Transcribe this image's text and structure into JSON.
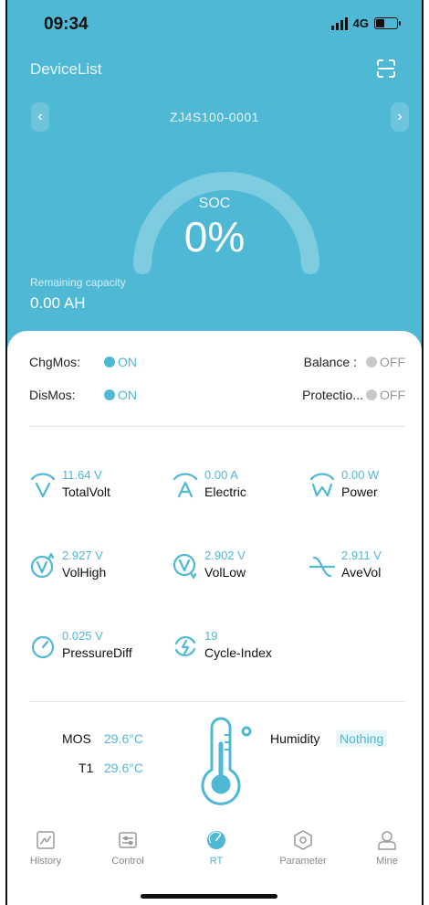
{
  "status": {
    "time": "09:34",
    "network": "4G"
  },
  "header": {
    "title": "DeviceList",
    "device": "ZJ4S100-0001",
    "prev": "‹",
    "next": "›"
  },
  "gauge": {
    "label": "SOC",
    "value": "0%",
    "soc_fraction": 0
  },
  "remaining": {
    "label": "Remaining capacity",
    "value": "0.00 AH"
  },
  "mos": {
    "chg_label": "ChgMos:",
    "chg_state": "ON",
    "dis_label": "DisMos:",
    "dis_state": "ON",
    "balance_label": "Balance :",
    "balance_state": "OFF",
    "protect_label": "Protectio...",
    "protect_state": "OFF"
  },
  "metrics": [
    {
      "value": "11.64 V",
      "label": "TotalVolt",
      "icon": "total-volt-icon"
    },
    {
      "value": "0.00 A",
      "label": "Electric",
      "icon": "electric-icon"
    },
    {
      "value": "0.00 W",
      "label": "Power",
      "icon": "power-icon"
    },
    {
      "value": "2.927 V",
      "label": "VolHigh",
      "icon": "vol-high-icon"
    },
    {
      "value": "2.902 V",
      "label": "VolLow",
      "icon": "vol-low-icon"
    },
    {
      "value": "2.911 V",
      "label": "AveVol",
      "icon": "ave-vol-icon"
    },
    {
      "value": "0.025 V",
      "label": "PressureDiff",
      "icon": "pressure-diff-icon"
    },
    {
      "value": "19",
      "label": "Cycle-Index",
      "icon": "cycle-index-icon"
    }
  ],
  "temps": {
    "mos_label": "MOS",
    "mos_value": "29.6°C",
    "t1_label": "T1",
    "t1_value": "29.6°C",
    "humidity_label": "Humidity",
    "humidity_value": "Nothing"
  },
  "tabs": [
    {
      "label": "History",
      "icon": "history-icon"
    },
    {
      "label": "Control",
      "icon": "control-icon"
    },
    {
      "label": "RT",
      "icon": "rt-icon",
      "active": true
    },
    {
      "label": "Parameter",
      "icon": "parameter-icon"
    },
    {
      "label": "Mine",
      "icon": "mine-icon"
    }
  ],
  "colors": {
    "accent": "#4fb8d4",
    "inactive": "#c8c8c8"
  }
}
